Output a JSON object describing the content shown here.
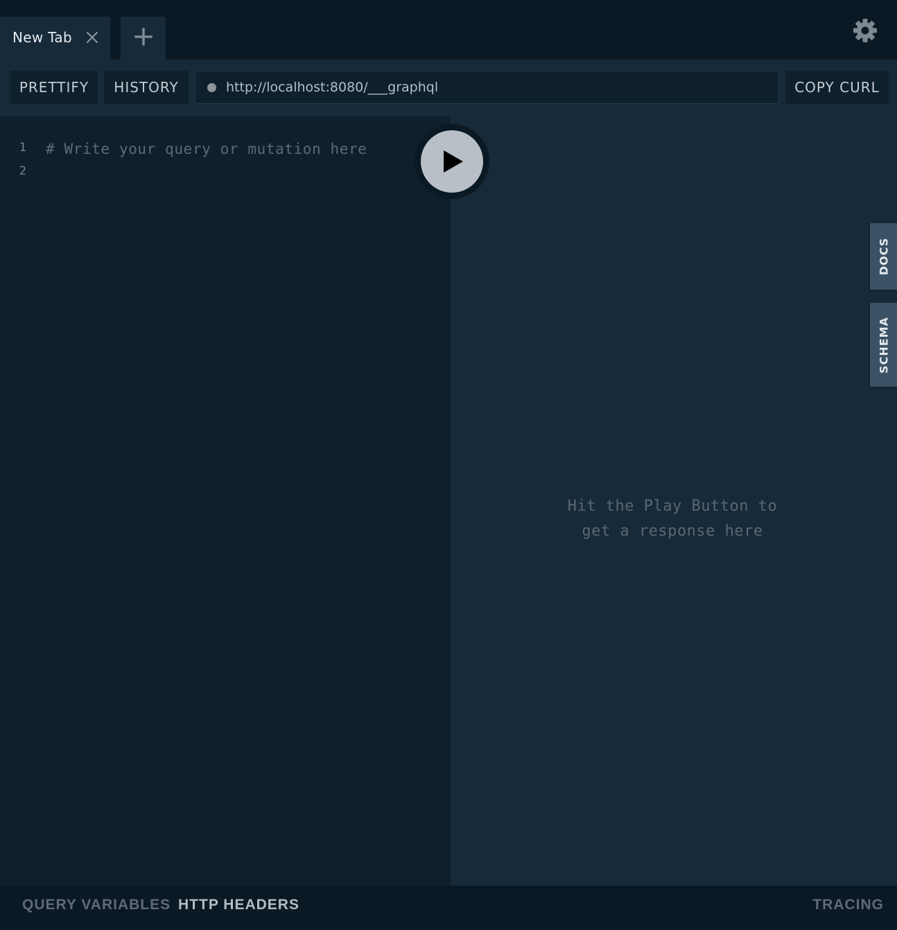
{
  "tabs": {
    "items": [
      {
        "label": "New Tab"
      }
    ]
  },
  "toolbar": {
    "prettify_label": "PRETTIFY",
    "history_label": "HISTORY",
    "endpoint_value": "http://localhost:8080/___graphql",
    "copy_curl_label": "COPY CURL"
  },
  "editor": {
    "line_numbers": [
      "1",
      "2"
    ],
    "lines": [
      "# Write your query or mutation here",
      ""
    ]
  },
  "result": {
    "hint_line1": "Hit the Play Button to",
    "hint_line2": "get a response here"
  },
  "side_tabs": {
    "docs_label": "DOCS",
    "schema_label": "SCHEMA"
  },
  "bottom": {
    "query_variables_label": "QUERY VARIABLES",
    "http_headers_label": "HTTP HEADERS",
    "tracing_label": "TRACING"
  },
  "icons": {
    "tab_close": "close-icon",
    "add_tab": "plus-icon",
    "settings": "gear-icon",
    "run": "play-icon",
    "status": "status-dot-icon"
  },
  "colors": {
    "editor_bg": "#0f202d",
    "result_bg": "#172a3a",
    "side_tab_bg": "#3b5264",
    "play_button": "#b9bfc6"
  }
}
